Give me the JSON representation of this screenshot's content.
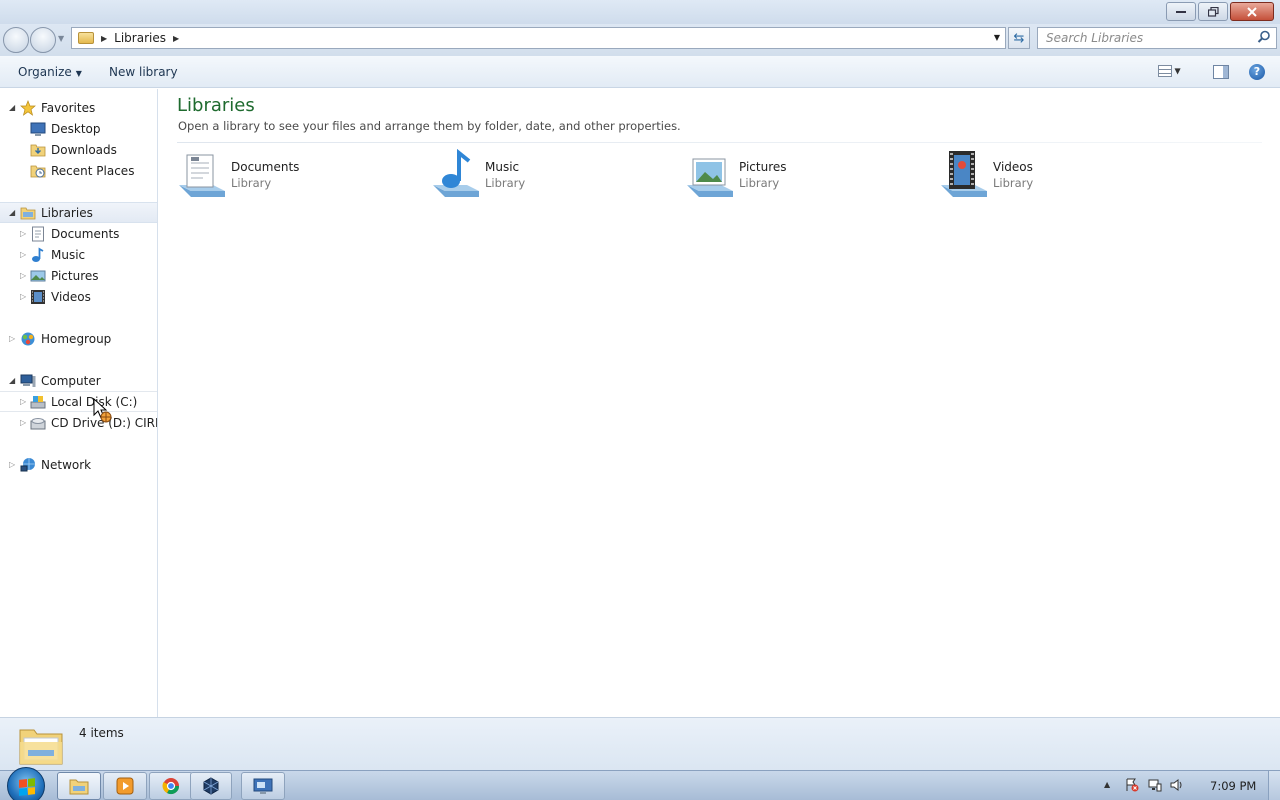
{
  "window": {
    "address": {
      "crumb": "Libraries"
    },
    "search": {
      "placeholder": "Search Libraries"
    },
    "controls": [
      "minimize-icon",
      "restore-icon",
      "close-icon"
    ]
  },
  "toolbar": {
    "organize_label": "Organize",
    "new_library_label": "New library"
  },
  "sidebar": {
    "favorites": {
      "label": "Favorites",
      "items": [
        "Desktop",
        "Downloads",
        "Recent Places"
      ]
    },
    "libraries": {
      "label": "Libraries",
      "items": [
        "Documents",
        "Music",
        "Pictures",
        "Videos"
      ]
    },
    "homegroup": {
      "label": "Homegroup"
    },
    "computer": {
      "label": "Computer",
      "items": [
        "Local Disk (C:)",
        "CD Drive (D:) CIRRUS"
      ]
    },
    "network": {
      "label": "Network"
    }
  },
  "main": {
    "title": "Libraries",
    "subtitle": "Open a library to see your files and arrange them by folder, date, and other properties.",
    "libraries": [
      {
        "name": "Documents",
        "type": "Library",
        "icon": "documents-library-icon"
      },
      {
        "name": "Music",
        "type": "Library",
        "icon": "music-library-icon"
      },
      {
        "name": "Pictures",
        "type": "Library",
        "icon": "pictures-library-icon"
      },
      {
        "name": "Videos",
        "type": "Library",
        "icon": "videos-library-icon"
      }
    ]
  },
  "details": {
    "count": "4 items"
  },
  "taskbar": {
    "apps": [
      "windows-explorer-icon",
      "media-player-icon",
      "chrome-icon",
      "virtualbox-icon",
      "remote-desktop-icon"
    ],
    "clock": "7:09 PM"
  },
  "colors": {
    "title_green": "#1e6a2e",
    "accent_blue": "#1a58a6"
  }
}
